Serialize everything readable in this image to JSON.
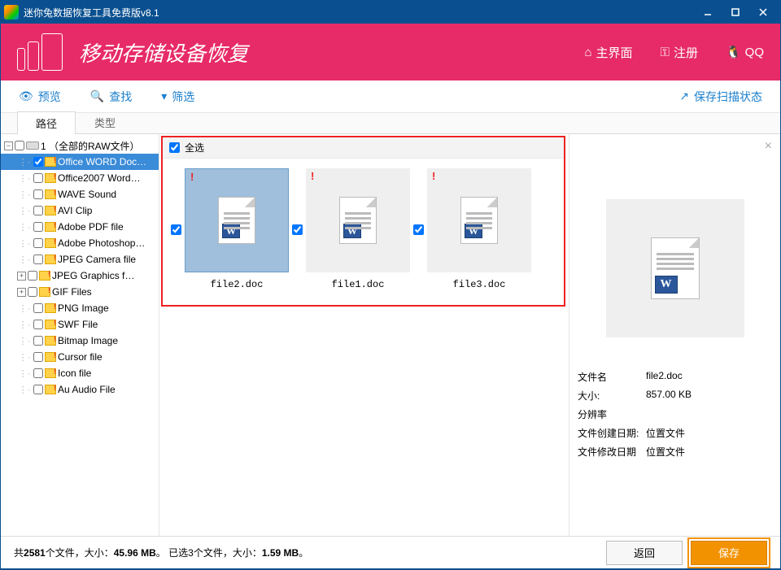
{
  "titlebar": {
    "title": "迷你兔数据恢复工具免费版v8.1"
  },
  "topbar": {
    "heading": "移动存储设备恢复",
    "links": {
      "home": "主界面",
      "register": "注册",
      "qq": "QQ"
    }
  },
  "toolbar": {
    "preview": "预览",
    "find": "查找",
    "filter": "筛选",
    "save_scan": "保存扫描状态"
  },
  "tabs": {
    "path": "路径",
    "type": "类型"
  },
  "tree": {
    "root": "1 （全部的RAW文件）",
    "items": [
      "Office WORD Doc…",
      "Office2007 Word…",
      "WAVE Sound",
      "AVI Clip",
      "Adobe PDF file",
      "Adobe Photoshop…",
      "JPEG Camera file",
      "JPEG Graphics f…",
      "GIF Files",
      "PNG Image",
      "SWF File",
      "Bitmap Image",
      "Cursor file",
      "Icon file",
      "Au Audio File"
    ]
  },
  "grid": {
    "select_all": "全选",
    "files": [
      {
        "name": "file2.doc",
        "selected": true
      },
      {
        "name": "file1.doc",
        "selected": false
      },
      {
        "name": "file3.doc",
        "selected": false
      }
    ]
  },
  "preview": {
    "labels": {
      "filename": "文件名",
      "size": "大小:",
      "resolution": "分辨率",
      "created": "文件创建日期:",
      "modified": "文件修改日期"
    },
    "values": {
      "filename": "file2.doc",
      "size": "857.00 KB",
      "resolution": "",
      "created": "位置文件",
      "modified": "位置文件"
    }
  },
  "status": {
    "total_prefix": "共",
    "total_count": "2581",
    "total_mid": "个文件，大小：",
    "total_size": "45.96 MB",
    "sep": "。   ",
    "sel_prefix": "已选",
    "sel_count": "3",
    "sel_mid": "个文件，大小：",
    "sel_size": "1.59 MB",
    "end": "。"
  },
  "buttons": {
    "back": "返回",
    "save": "保存"
  }
}
